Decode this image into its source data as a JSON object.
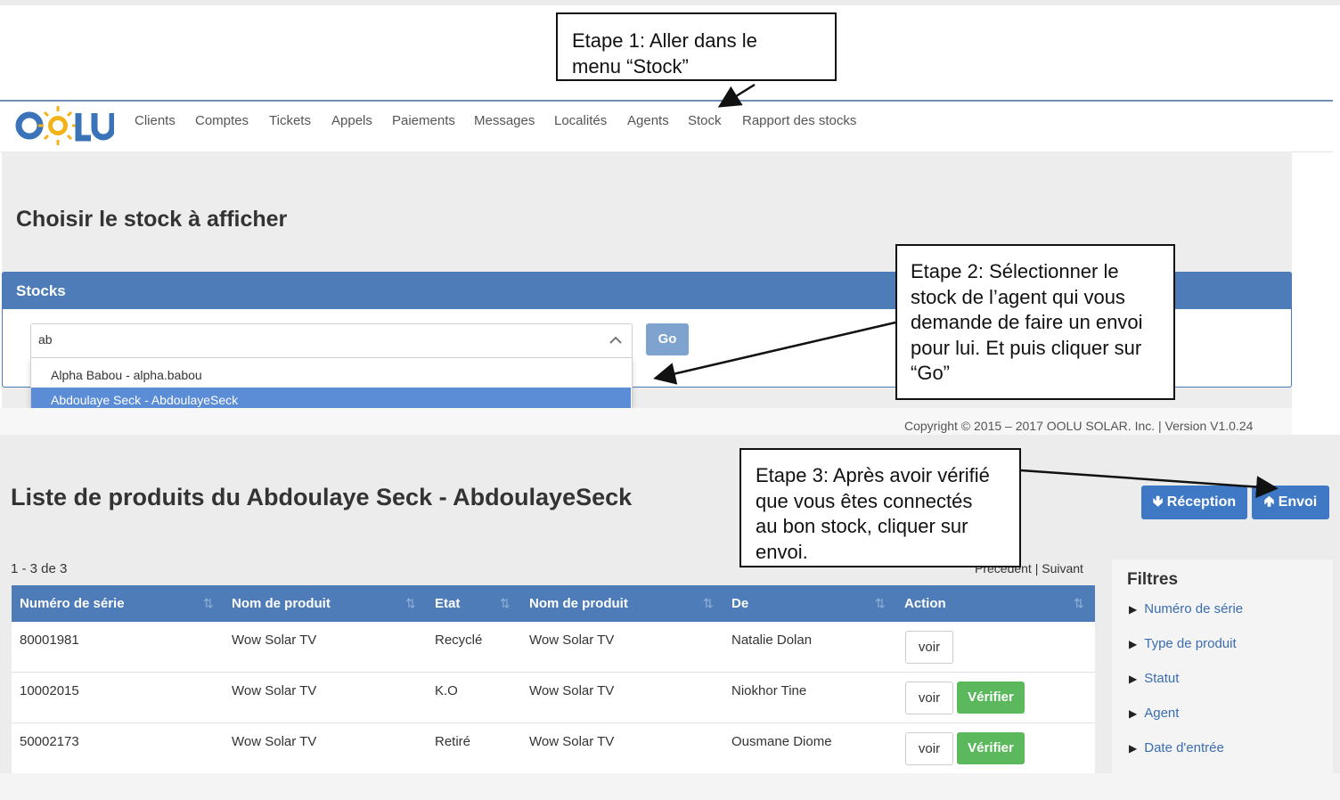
{
  "brand": {
    "logo": "OOLU",
    "accent": "#4d7cb8",
    "logo_color": "#3b73b9",
    "sun_color": "#f2b318"
  },
  "nav": {
    "items": [
      "Clients",
      "Comptes",
      "Tickets",
      "Appels",
      "Paiements",
      "Messages",
      "Localités",
      "Agents",
      "Stock",
      "Rapport des stocks"
    ]
  },
  "stock_page": {
    "title": "Choisir le stock à afficher",
    "panel_title": "Stocks",
    "search_value": "ab",
    "chevron_icon": "chevron-up-icon",
    "options": [
      "Alpha Babou - alpha.babou",
      "Abdoulaye Seck - AbdoulayeSeck"
    ],
    "selected_option": "Abdoulaye Seck - AbdoulayeSeck",
    "go_label": "Go",
    "copyright": "Copyright © 2015 – 2017 OOLU SOLAR. Inc. | Version V1.0.24"
  },
  "product_list": {
    "title": "Liste de produits du Abdoulaye Seck - AbdoulayeSeck",
    "reception_label": "Réception",
    "envoi_label": "Envoi",
    "count": "1 - 3 de 3",
    "pagination": "Précédent | Suivant",
    "columns": [
      "Numéro de série",
      "Nom de produit",
      "Etat",
      "Nom de produit",
      "De",
      "Action"
    ],
    "rows": [
      {
        "serial": "80001981",
        "product": "Wow Solar TV",
        "state": "Recyclé",
        "product2": "Wow Solar TV",
        "from": "Natalie Dolan",
        "voir": "voir",
        "verify": ""
      },
      {
        "serial": "10002015",
        "product": "Wow Solar TV",
        "state": "K.O",
        "product2": "Wow Solar TV",
        "from": "Niokhor Tine",
        "voir": "voir",
        "verify": "Vérifier"
      },
      {
        "serial": "50002173",
        "product": "Wow Solar TV",
        "state": "Retiré",
        "product2": "Wow Solar TV",
        "from": "Ousmane Diome",
        "voir": "voir",
        "verify": "Vérifier"
      }
    ],
    "filters": {
      "title": "Filtres",
      "items": [
        "Numéro de série",
        "Type de produit",
        "Statut",
        "Agent",
        "Date d'entrée"
      ]
    }
  },
  "annotations": {
    "step1": [
      "Etape 1: Aller dans le",
      "menu “Stock”"
    ],
    "step2": [
      "Etape 2: Sélectionner le",
      "stock de l’agent qui vous",
      "demande de faire un envoi",
      "pour lui. Et puis cliquer sur",
      "“Go”"
    ],
    "step3": [
      "Etape 3: Après avoir vérifié",
      "que vous êtes connectés",
      "au bon stock, cliquer sur",
      "envoi."
    ]
  }
}
